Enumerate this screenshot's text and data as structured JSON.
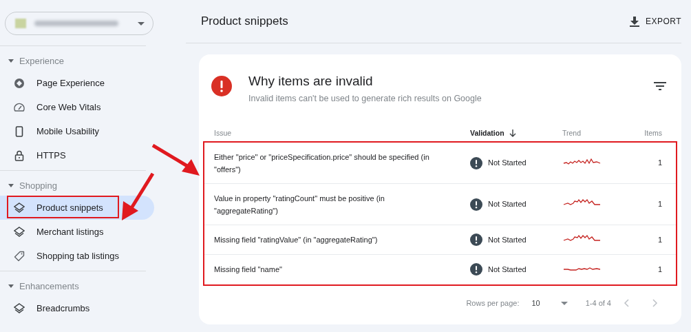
{
  "sidebar": {
    "sections": [
      {
        "title": "Experience",
        "expanded": true,
        "items": [
          {
            "label": "Page Experience",
            "kind": "experience",
            "selected": false
          },
          {
            "label": "Core Web Vitals",
            "kind": "gauge",
            "selected": false
          },
          {
            "label": "Mobile Usability",
            "kind": "phone",
            "selected": false
          },
          {
            "label": "HTTPS",
            "kind": "lock",
            "selected": false
          }
        ]
      },
      {
        "title": "Shopping",
        "expanded": true,
        "items": [
          {
            "label": "Product snippets",
            "kind": "layers",
            "selected": true
          },
          {
            "label": "Merchant listings",
            "kind": "layers",
            "selected": false
          },
          {
            "label": "Shopping tab listings",
            "kind": "tag",
            "selected": false
          }
        ]
      },
      {
        "title": "Enhancements",
        "expanded": true,
        "items": [
          {
            "label": "Breadcrumbs",
            "kind": "layers",
            "selected": false
          }
        ]
      }
    ]
  },
  "page": {
    "title": "Product snippets",
    "export_label": "EXPORT"
  },
  "card": {
    "title": "Why items are invalid",
    "subtitle": "Invalid items can't be used to generate rich results on Google",
    "columns": [
      "Issue",
      "Validation",
      "Trend",
      "Items"
    ],
    "rows": [
      {
        "issue": "Either \"price\" or \"priceSpecification.price\" should be specified (in \"offers\")",
        "validation": "Not Started",
        "items": "1"
      },
      {
        "issue": "Value in property \"ratingCount\" must be positive (in \"aggregateRating\")",
        "validation": "Not Started",
        "items": "1"
      },
      {
        "issue": "Missing field \"ratingValue\" (in \"aggregateRating\")",
        "validation": "Not Started",
        "items": "1"
      },
      {
        "issue": "Missing field \"name\"",
        "validation": "Not Started",
        "items": "1"
      }
    ],
    "pagination": {
      "rows_per_page_label": "Rows per page:",
      "rows_per_page": "10",
      "range": "1-4 of 4"
    }
  }
}
